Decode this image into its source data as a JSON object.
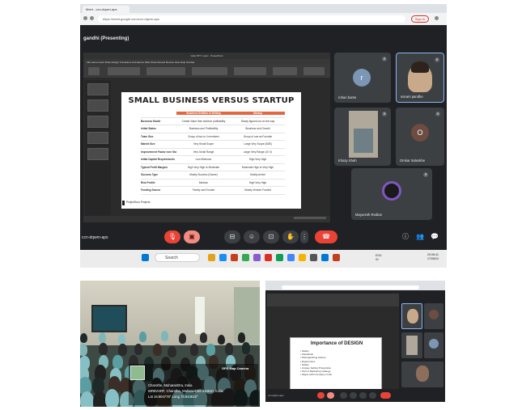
{
  "top": {
    "tab_title": "Meet - ccn-dqwm-aps",
    "url": "https://meet.google.com/ccn-dqwm-aps",
    "signin_label": "Sign in",
    "presenting_label": "gandhi (Presenting)",
    "ppt": {
      "window_title": "Cafe PPT 1.pptx - PowerPoint",
      "menu": "File   Home   Insert   Draw   Design   Transitions   Animations   Slide Show   Record   Review   View   Help   Acrobat"
    },
    "slide": {
      "title": "SMALL BUSINESS VERSUS STARTUP",
      "columns": [
        "",
        "Business Entities in Writing",
        "Startup"
      ],
      "rows": [
        [
          "Business Model",
          "Create Value then Achieve profitability",
          "Slowly figured out on the way"
        ],
        [
          "Initial Status",
          "Business and Profitability",
          "Business and Growth"
        ],
        [
          "Team Size",
          "Group of two to 4 members",
          "Group of one as Founder"
        ],
        [
          "Market Size",
          "Very Small Scope",
          "Large Very Scope (B2B)"
        ],
        [
          "Improvement Factor over State of the Art",
          "Very Small Range",
          "Large Very Range (10 X)"
        ],
        [
          "Initial Capital Requirements",
          "Low Minimum",
          "High Very High"
        ],
        [
          "Typical Profit Margins",
          "High Very High to Moderate",
          "Moderate High to Very High"
        ],
        [
          "Success Type",
          "Mostly Success (Owner)",
          "Mostly Acrive"
        ],
        [
          "Risk Profile",
          "Medium",
          "High Very High"
        ],
        [
          "Funding Source",
          "Family and Funded",
          "Mostly Venture Funded"
        ]
      ],
      "footer": "ProjectGuru Projects"
    },
    "participants": [
      {
        "name": "rohan barse",
        "initial": "r",
        "color": "#7c97b5"
      },
      {
        "name": "sonam pandhe",
        "initial": "",
        "color": "#c8a98a"
      },
      {
        "name": "Khazy Shah",
        "initial": "",
        "color": "#b0a89a"
      },
      {
        "name": "Omkar Salunkhe",
        "initial": "O",
        "color": "#6d4c41"
      },
      {
        "name": "Mayuresh Redkar",
        "initial": "",
        "color": "#5a2d82"
      }
    ],
    "meeting_code": "ccn-dqwm-aps",
    "taskbar": {
      "search_placeholder": "Search",
      "tray": "ENG\nIN",
      "clock": "20:08:41\n17/08/24"
    }
  },
  "photo": {
    "brand": "GPS Map Camera",
    "lines": [
      "Charothe, Maharashtra, India",
      "WR5VHRF, Charothe, Maharashtra 416510, India",
      "Lat 16.904778° Long 73.844519°"
    ]
  },
  "small": {
    "slide_title": "Importance of DESIGN",
    "bullets": [
      "Safety",
      "Standards",
      "Distinguishing feature",
      "Ergonomics",
      "Safety",
      "Unique Selling Proposition",
      "Part of Marketing strategy",
      "Aligns with Company motto"
    ],
    "meeting_code": "ccn-dqwm-aps"
  }
}
